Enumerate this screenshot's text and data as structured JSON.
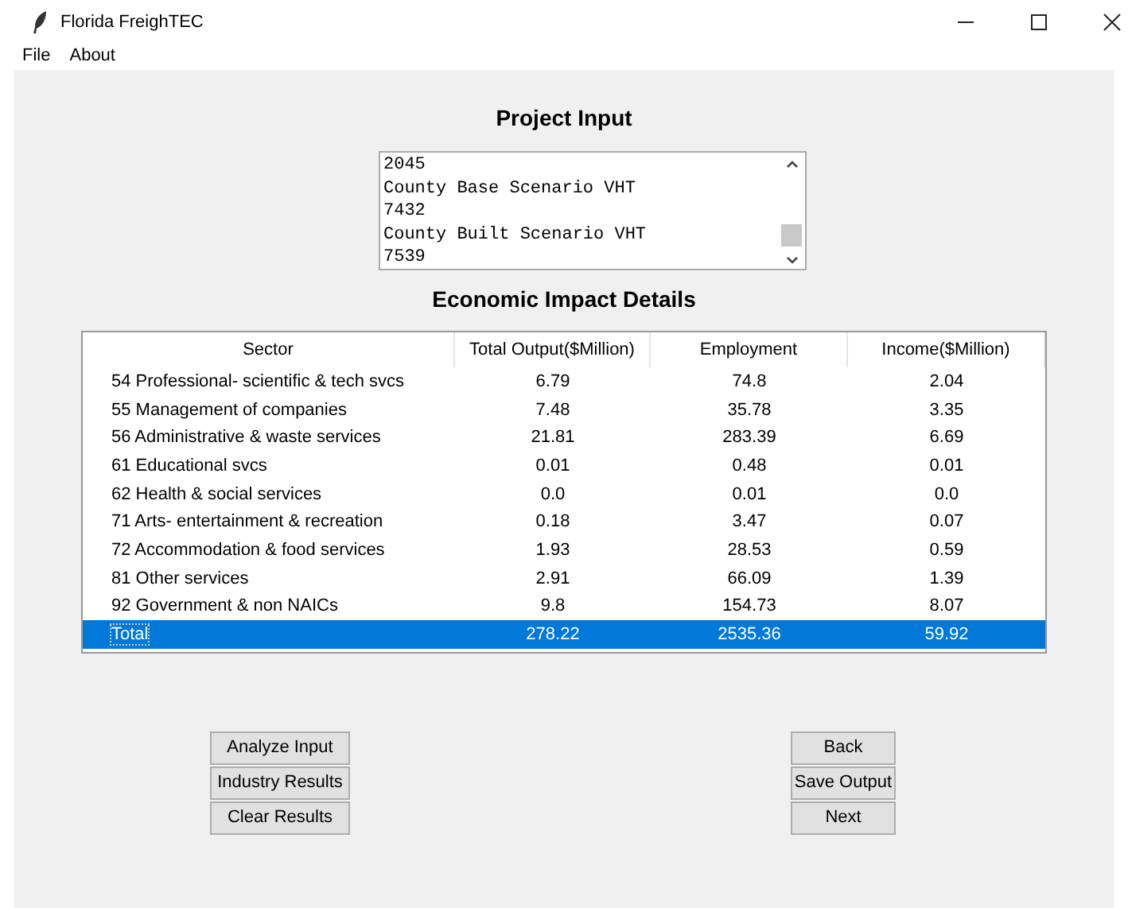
{
  "window": {
    "title": "Florida FreighTEC"
  },
  "menu": [
    "File",
    "About"
  ],
  "project_input": {
    "heading": "Project Input",
    "lines": [
      "2045",
      "County Base Scenario VHT",
      "7432",
      "County Built Scenario VHT",
      "7539"
    ]
  },
  "table": {
    "heading": "Economic Impact Details",
    "columns": [
      "Sector",
      "Total Output($Million)",
      "Employment",
      "Income($Million)"
    ],
    "rows": [
      {
        "cells": [
          "54 Professional- scientific & tech svcs",
          "6.79",
          "74.8",
          "2.04"
        ],
        "selected": false
      },
      {
        "cells": [
          "55 Management of companies",
          "7.48",
          "35.78",
          "3.35"
        ],
        "selected": false
      },
      {
        "cells": [
          "56 Administrative & waste services",
          "21.81",
          "283.39",
          "6.69"
        ],
        "selected": false
      },
      {
        "cells": [
          "61 Educational svcs",
          "0.01",
          "0.48",
          "0.01"
        ],
        "selected": false
      },
      {
        "cells": [
          "62 Health & social services",
          "0.0",
          "0.01",
          "0.0"
        ],
        "selected": false
      },
      {
        "cells": [
          "71 Arts- entertainment & recreation",
          "0.18",
          "3.47",
          "0.07"
        ],
        "selected": false
      },
      {
        "cells": [
          "72 Accommodation & food services",
          "1.93",
          "28.53",
          "0.59"
        ],
        "selected": false
      },
      {
        "cells": [
          "81 Other services",
          "2.91",
          "66.09",
          "1.39"
        ],
        "selected": false
      },
      {
        "cells": [
          "92 Government & non NAICs",
          "9.8",
          "154.73",
          "8.07"
        ],
        "selected": false
      },
      {
        "cells": [
          "Total",
          "278.22",
          "2535.36",
          "59.92"
        ],
        "selected": true
      }
    ]
  },
  "left_buttons": [
    "Analyze Input",
    "Industry Results",
    "Clear Results"
  ],
  "right_buttons": [
    "Back",
    "Save Output",
    "Next"
  ]
}
